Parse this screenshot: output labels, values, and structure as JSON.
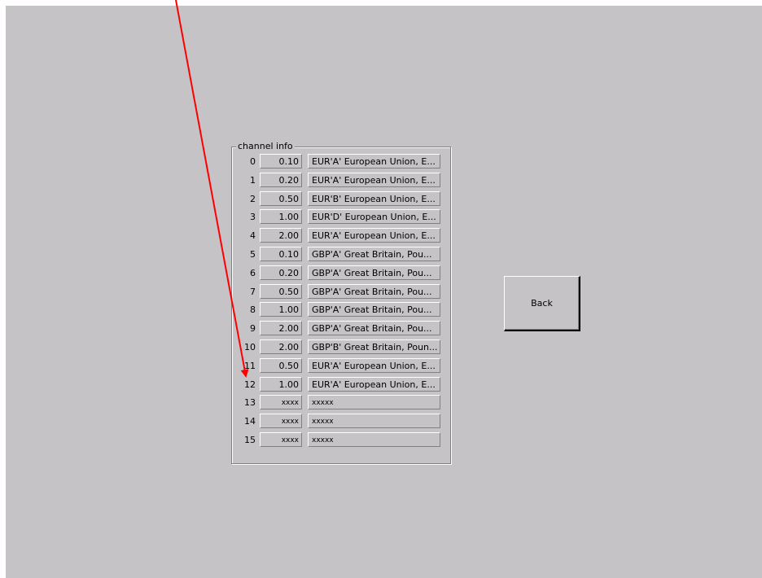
{
  "group_title": "channel info",
  "channels": [
    {
      "index": "0",
      "value": "0.10",
      "description": "EUR'A' European Union, E..."
    },
    {
      "index": "1",
      "value": "0.20",
      "description": "EUR'A' European Union, E..."
    },
    {
      "index": "2",
      "value": "0.50",
      "description": "EUR'B' European Union, E..."
    },
    {
      "index": "3",
      "value": "1.00",
      "description": "EUR'D' European Union, E..."
    },
    {
      "index": "4",
      "value": "2.00",
      "description": "EUR'A' European Union, E..."
    },
    {
      "index": "5",
      "value": "0.10",
      "description": "GBP'A' Great Britain, Pou..."
    },
    {
      "index": "6",
      "value": "0.20",
      "description": "GBP'A' Great Britain, Pou..."
    },
    {
      "index": "7",
      "value": "0.50",
      "description": "GBP'A' Great Britain, Pou..."
    },
    {
      "index": "8",
      "value": "1.00",
      "description": "GBP'A' Great Britain, Pou..."
    },
    {
      "index": "9",
      "value": "2.00",
      "description": "GBP'A' Great Britain, Pou..."
    },
    {
      "index": "10",
      "value": "2.00",
      "description": "GBP'B' Great Britain, Poun..."
    },
    {
      "index": "11",
      "value": "0.50",
      "description": "EUR'A' European Union, E..."
    },
    {
      "index": "12",
      "value": "1.00",
      "description": "EUR'A' European Union, E..."
    },
    {
      "index": "13",
      "value": "xxxx",
      "description": "xxxxx"
    },
    {
      "index": "14",
      "value": "xxxx",
      "description": "xxxxx"
    },
    {
      "index": "15",
      "value": "xxxx",
      "description": "xxxxx"
    }
  ],
  "back_button": {
    "label": "Back"
  },
  "annotation": {
    "color": "#ff0000"
  }
}
